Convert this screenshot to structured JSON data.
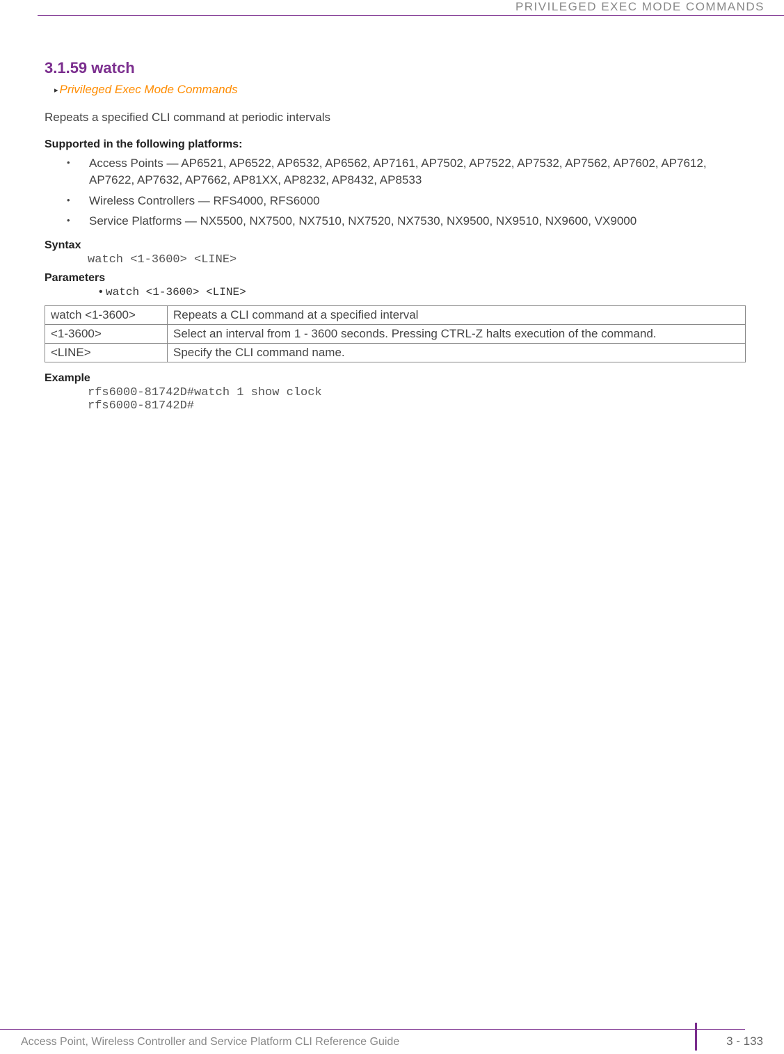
{
  "header": {
    "title": "PRIVILEGED EXEC MODE COMMANDS"
  },
  "section": {
    "title": "3.1.59 watch",
    "breadcrumb": "Privileged Exec Mode Commands",
    "intro": "Repeats a specified CLI command at periodic intervals"
  },
  "platforms": {
    "heading": "Supported in the following platforms:",
    "items": [
      "Access Points — AP6521, AP6522, AP6532, AP6562, AP7161, AP7502, AP7522, AP7532, AP7562, AP7602, AP7612, AP7622, AP7632, AP7662, AP81XX, AP8232, AP8432, AP8533",
      "Wireless Controllers — RFS4000, RFS6000",
      "Service Platforms — NX5500, NX7500, NX7510, NX7520, NX7530, NX9500, NX9510, NX9600, VX9000"
    ]
  },
  "syntax": {
    "heading": "Syntax",
    "code": "watch <1-3600> <LINE>"
  },
  "parameters": {
    "heading": "Parameters",
    "bullet": "watch <1-3600> <LINE>",
    "rows": [
      {
        "name": "watch <1-3600>",
        "desc": "Repeats a CLI command at a specified interval"
      },
      {
        "name": "<1-3600>",
        "desc": "Select an interval from 1 - 3600 seconds. Pressing CTRL-Z halts execution of the command."
      },
      {
        "name": "<LINE>",
        "desc": "Specify the CLI command name."
      }
    ]
  },
  "example": {
    "heading": "Example",
    "code": "rfs6000-81742D#watch 1 show clock\nrfs6000-81742D#"
  },
  "footer": {
    "text": "Access Point, Wireless Controller and Service Platform CLI Reference Guide",
    "page": "3 - 133"
  }
}
